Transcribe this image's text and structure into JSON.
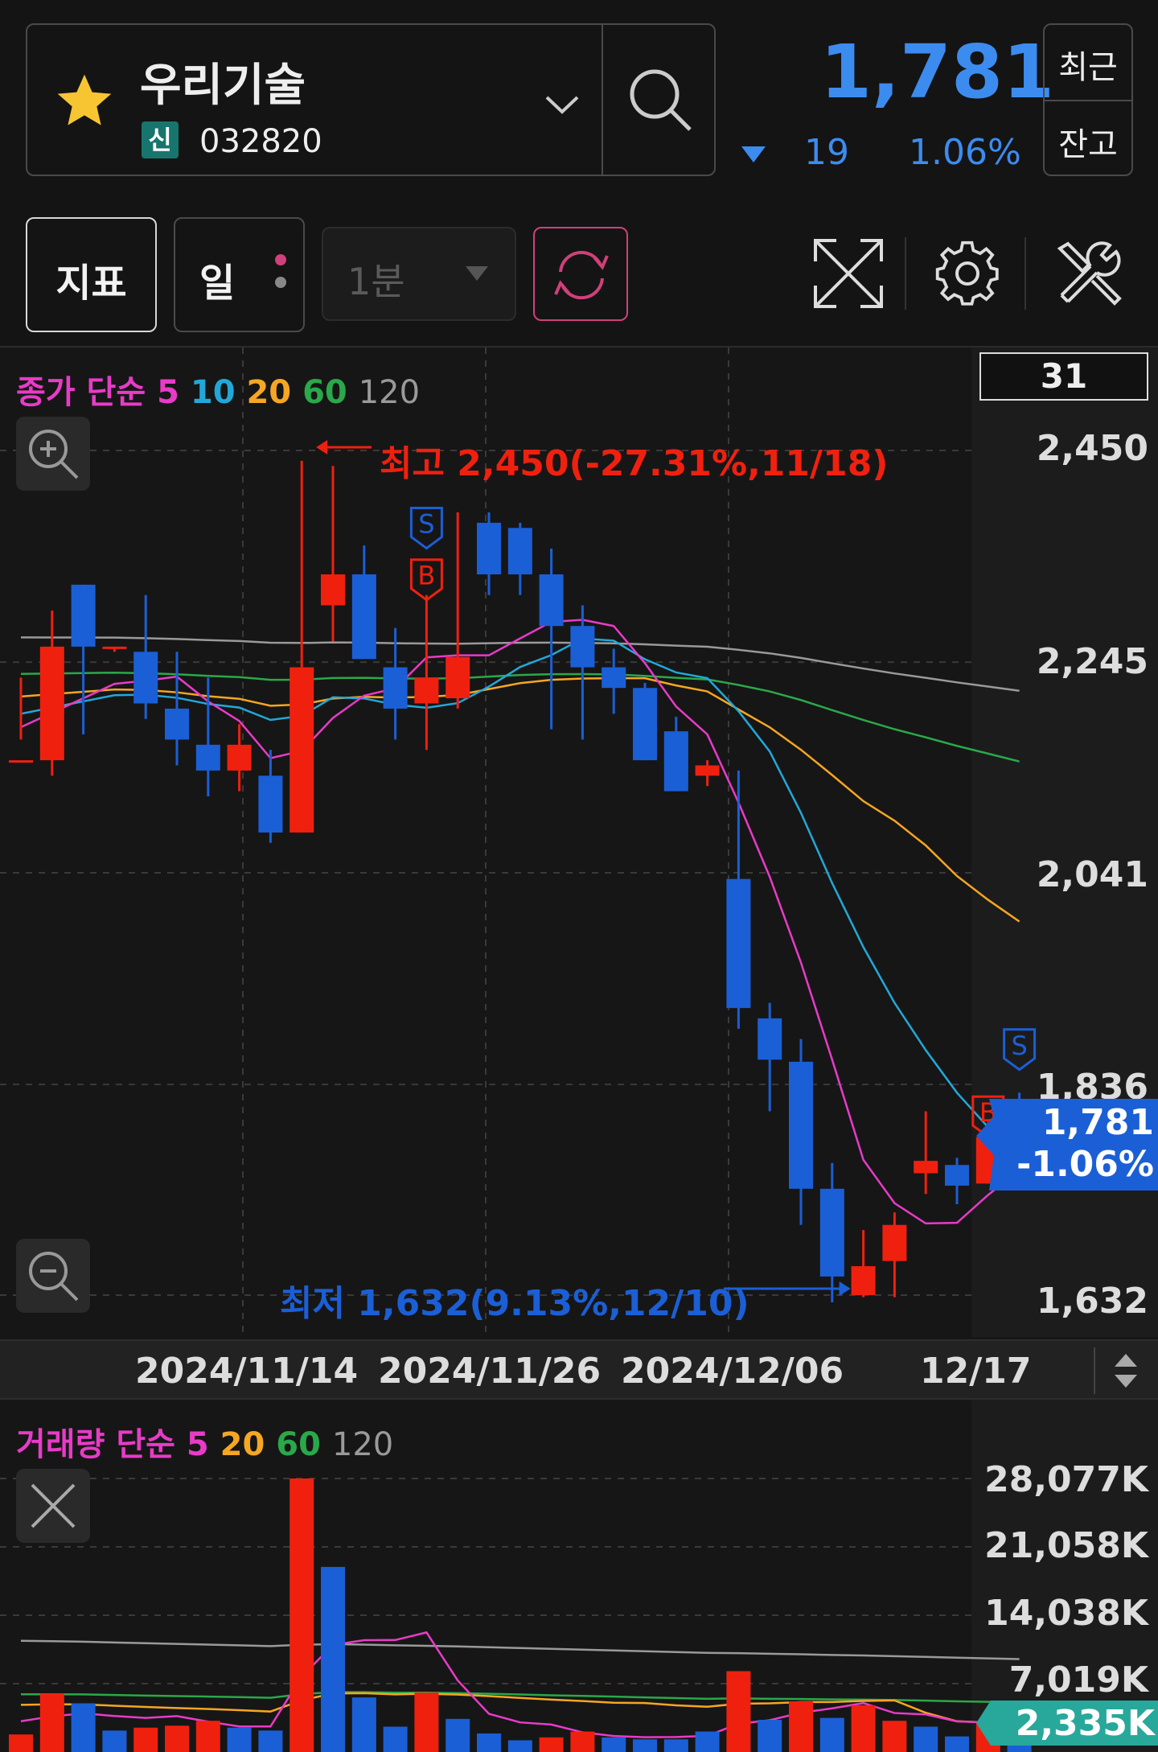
{
  "stock": {
    "name": "우리기술",
    "badge": "신",
    "code": "032820",
    "price": "1,781",
    "change": "19",
    "change_pct": "1.06%",
    "side_btn_top": "최근",
    "side_btn_bottom": "잔고"
  },
  "toolbar": {
    "indicator_label": "지표",
    "period_label": "일",
    "interval_label": "1분"
  },
  "colors": {
    "up": "#f0200f",
    "down": "#1b5fd6",
    "ma5": "#e83bc8",
    "ma10": "#22a8d8",
    "ma20": "#f5a623",
    "ma60": "#2aa84a",
    "ma120": "#9a9a9a"
  },
  "price_chart": {
    "legend": {
      "prefix": "종가 단순",
      "p5": "5",
      "p10": "10",
      "p20": "20",
      "p60": "60",
      "p120": "120"
    },
    "visible_count": "31",
    "y_ticks": [
      "2,450",
      "2,245",
      "2,041",
      "1,836",
      "1,632"
    ],
    "current_label": "1,781",
    "current_change": "-1.06%",
    "high_annotation": "최고 2,450(-27.31%,11/18)",
    "low_annotation": "최저 1,632(9.13%,12/10)",
    "x_ticks": [
      "2024/11/14",
      "2024/11/26",
      "2024/12/06",
      "12/17"
    ]
  },
  "volume_chart": {
    "legend": {
      "prefix": "거래량 단순",
      "p5": "5",
      "p20": "20",
      "p60": "60",
      "p120": "120"
    },
    "y_ticks": [
      "28,077K",
      "21,058K",
      "14,038K",
      "7,019K"
    ],
    "current_label": "2,335K"
  },
  "chart_data": [
    {
      "type": "candlestick",
      "title": "",
      "ylim": [
        1632,
        2450
      ],
      "ohlc": [
        {
          "o": 2150,
          "h": 2230,
          "l": 2170,
          "c": 2150
        },
        {
          "o": 2150,
          "h": 2295,
          "l": 2135,
          "c": 2260
        },
        {
          "o": 2320,
          "h": 2320,
          "l": 2175,
          "c": 2260
        },
        {
          "o": 2260,
          "h": 2260,
          "l": 2255,
          "c": 2260
        },
        {
          "o": 2255,
          "h": 2310,
          "l": 2190,
          "c": 2205
        },
        {
          "o": 2200,
          "h": 2255,
          "l": 2145,
          "c": 2170
        },
        {
          "o": 2165,
          "h": 2230,
          "l": 2115,
          "c": 2140
        },
        {
          "o": 2140,
          "h": 2185,
          "l": 2120,
          "c": 2165
        },
        {
          "o": 2135,
          "h": 2160,
          "l": 2070,
          "c": 2080
        },
        {
          "o": 2080,
          "h": 2440,
          "l": 2080,
          "c": 2240
        },
        {
          "o": 2300,
          "h": 2435,
          "l": 2265,
          "c": 2330
        },
        {
          "o": 2330,
          "h": 2358,
          "l": 2265,
          "c": 2248
        },
        {
          "o": 2240,
          "h": 2278,
          "l": 2170,
          "c": 2200
        },
        {
          "o": 2205,
          "h": 2310,
          "l": 2160,
          "c": 2230
        },
        {
          "o": 2210,
          "h": 2390,
          "l": 2200,
          "c": 2250
        },
        {
          "o": 2380,
          "h": 2390,
          "l": 2310,
          "c": 2330
        },
        {
          "o": 2375,
          "h": 2380,
          "l": 2310,
          "c": 2330
        },
        {
          "o": 2330,
          "h": 2355,
          "l": 2180,
          "c": 2280
        },
        {
          "o": 2280,
          "h": 2300,
          "l": 2170,
          "c": 2240
        },
        {
          "o": 2240,
          "h": 2258,
          "l": 2195,
          "c": 2220
        },
        {
          "o": 2220,
          "h": 2225,
          "l": 2150,
          "c": 2150
        },
        {
          "o": 2178,
          "h": 2192,
          "l": 2120,
          "c": 2120
        },
        {
          "o": 2135,
          "h": 2150,
          "l": 2125,
          "c": 2145
        },
        {
          "o": 2035,
          "h": 2140,
          "l": 1890,
          "c": 1910
        },
        {
          "o": 1900,
          "h": 1915,
          "l": 1810,
          "c": 1860
        },
        {
          "o": 1858,
          "h": 1880,
          "l": 1700,
          "c": 1735
        },
        {
          "o": 1735,
          "h": 1760,
          "l": 1625,
          "c": 1650
        },
        {
          "o": 1632,
          "h": 1695,
          "l": 1630,
          "c": 1660
        },
        {
          "o": 1665,
          "h": 1712,
          "l": 1630,
          "c": 1700
        },
        {
          "o": 1750,
          "h": 1810,
          "l": 1730,
          "c": 1762
        },
        {
          "o": 1758,
          "h": 1765,
          "l": 1720,
          "c": 1738
        },
        {
          "o": 1740,
          "h": 1800,
          "l": 1740,
          "c": 1785
        },
        {
          "o": 1810,
          "h": 1828,
          "l": 1765,
          "c": 1781
        }
      ]
    },
    {
      "type": "bar",
      "title": "",
      "ylim": [
        0,
        28077
      ],
      "values": [
        1800,
        6000,
        5000,
        2200,
        2500,
        2700,
        3200,
        2500,
        2200,
        28077,
        19000,
        5600,
        2600,
        6100,
        3400,
        1900,
        1200,
        1500,
        2100,
        1500,
        1300,
        1300,
        2100,
        8300,
        3300,
        5200,
        3500,
        4800,
        3200,
        2600,
        1600,
        3000,
        2335
      ],
      "up": [
        1,
        1,
        0,
        0,
        1,
        1,
        1,
        0,
        0,
        1,
        0,
        0,
        0,
        1,
        0,
        0,
        0,
        1,
        1,
        0,
        0,
        0,
        0,
        1,
        0,
        1,
        0,
        1,
        1,
        0,
        0,
        1,
        0
      ]
    }
  ]
}
